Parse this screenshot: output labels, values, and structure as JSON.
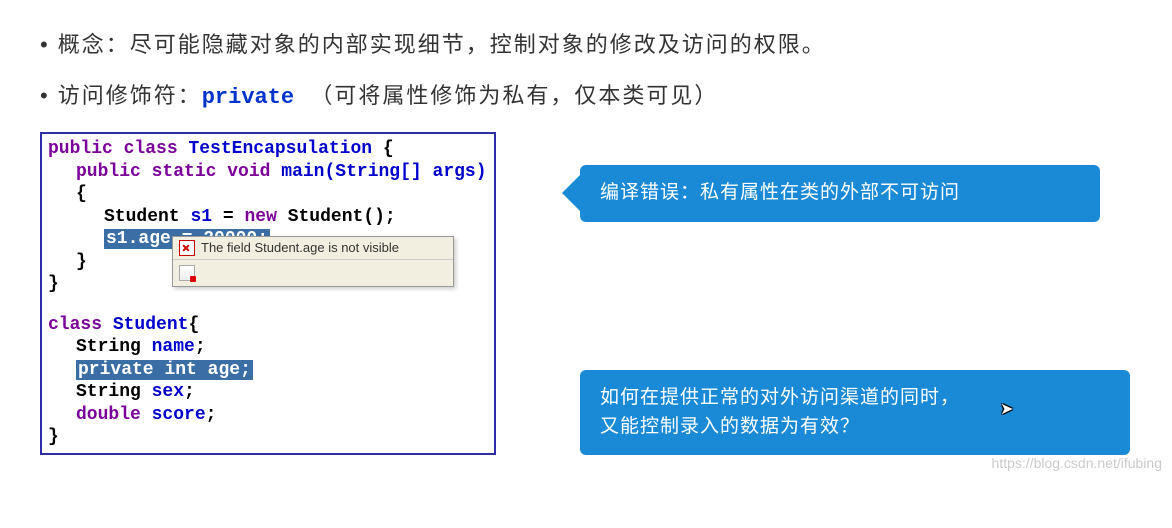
{
  "bullets": {
    "b1_label": "概念：",
    "b1_text": "尽可能隐藏对象的内部实现细节，控制对象的修改及访问的权限。",
    "b2_label": "访问修饰符：",
    "b2_keyword": "private",
    "b2_tail": "（可将属性修饰为私有，仅本类可见）"
  },
  "code": {
    "l1a": "public",
    "l1b": "class",
    "l1c": "TestEncapsulation",
    "l1d": "{",
    "l2a": "public",
    "l2b": "static",
    "l2c": "void",
    "l2d": "main(String[]",
    "l2e": "args)",
    "l2f": "{",
    "l3a": "Student",
    "l3b": "s1",
    "l3c": "=",
    "l3d": "new",
    "l3e": "Student();",
    "l4a": "s1.age",
    "l4b": "= 20000;",
    "l5": "}",
    "l6": "}",
    "l7a": "class",
    "l7b": "Student",
    "l7c": "{",
    "l8a": "String",
    "l8b": "name",
    "l8c": ";",
    "l9a": "private",
    "l9b": "int",
    "l9c": "age",
    "l9d": ";",
    "l10a": "String",
    "l10b": "sex",
    "l10c": ";",
    "l11a": "double",
    "l11b": "score",
    "l11c": ";",
    "l12": "}"
  },
  "tooltip": {
    "msg": "The field Student.age is not visible"
  },
  "callouts": {
    "top": "编译错误：私有属性在类的外部不可访问",
    "bottom_l1": "如何在提供正常的对外访问渠道的同时，",
    "bottom_l2": "又能控制录入的数据为有效？"
  },
  "watermark": "https://blog.csdn.net/ifubing"
}
